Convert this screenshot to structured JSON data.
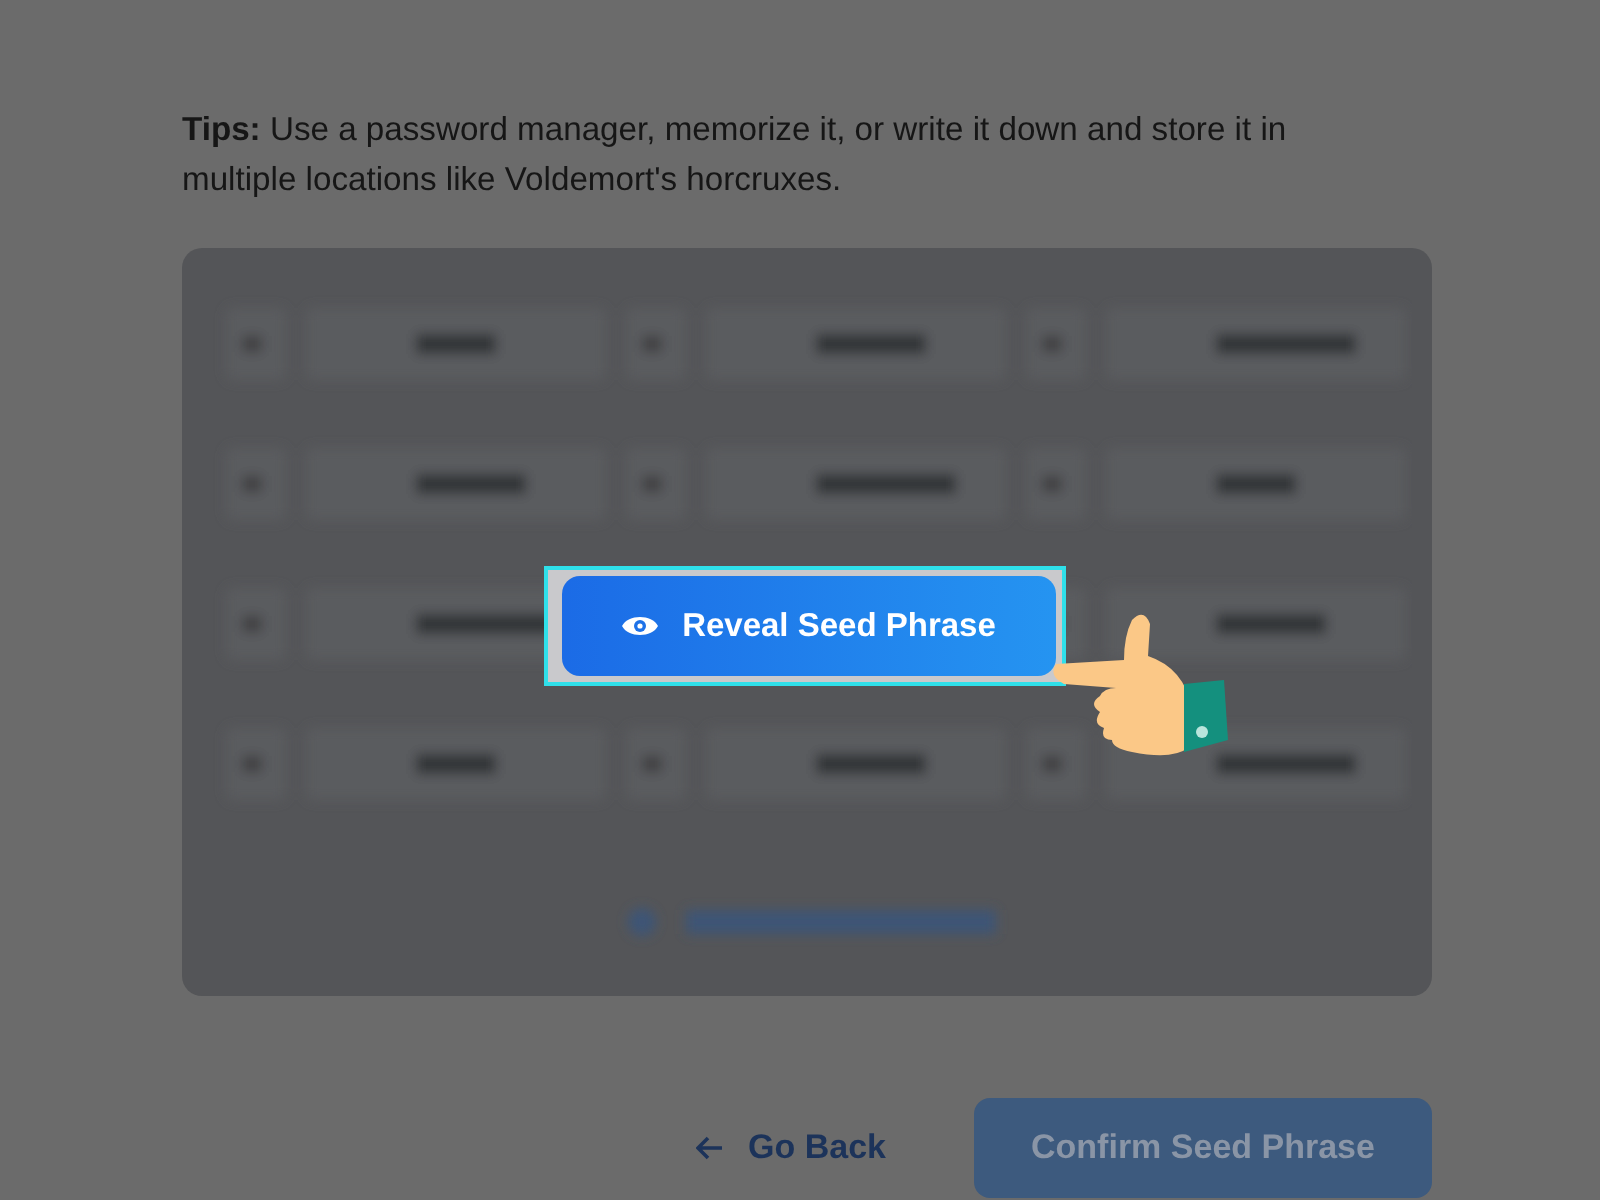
{
  "tips": "**Tips:** Use a password manager, memorize it, or write it down and store it in multiple locations like Voldemort's horcruxes.",
  "reveal_button": {
    "label": "Reveal Seed Phrase",
    "highlighted": true
  },
  "go_back": {
    "label": "Go Back"
  },
  "confirm_button": {
    "label": "Confirm Seed Phrase",
    "disabled": true
  }
}
